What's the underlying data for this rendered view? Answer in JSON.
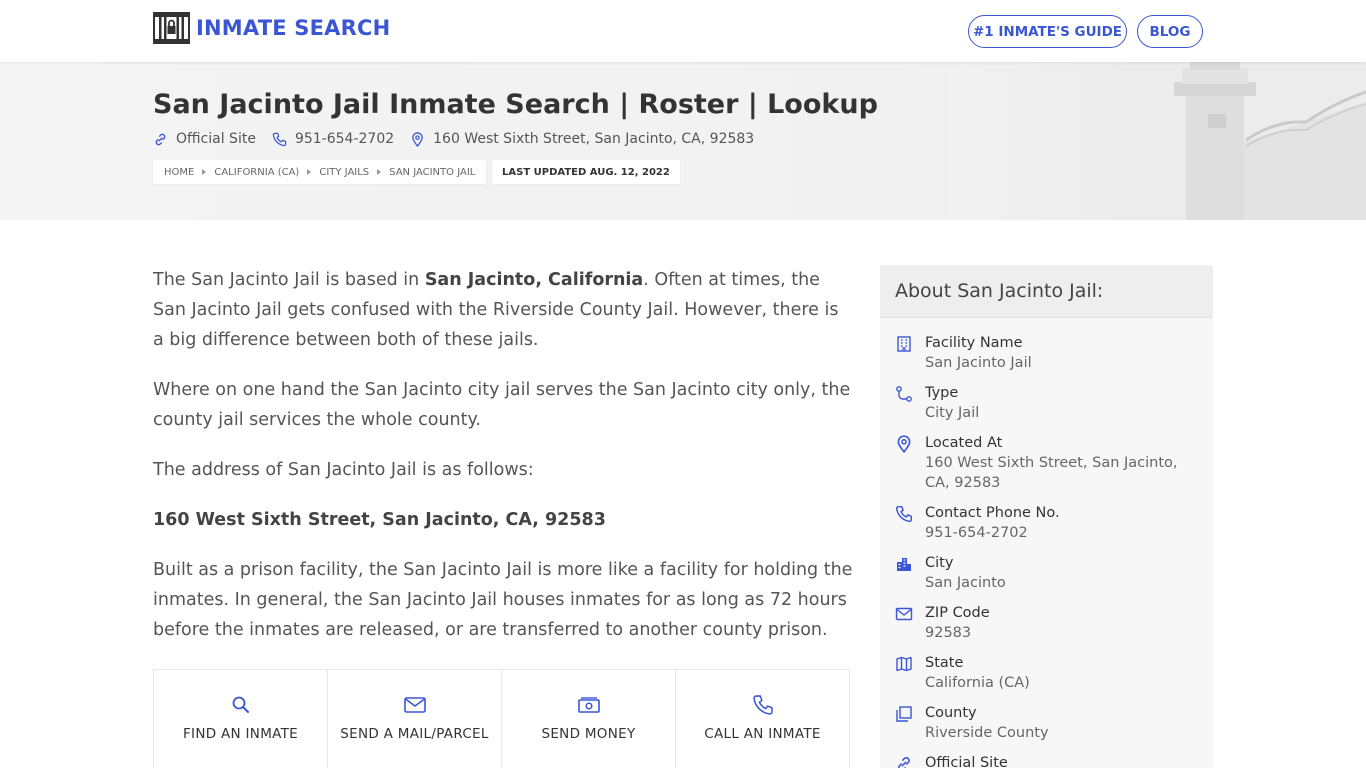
{
  "header": {
    "logo_text": "INMATE SEARCH",
    "nav": {
      "guide_label": "#1 INMATE'S GUIDE",
      "blog_label": "BLOG"
    }
  },
  "hero": {
    "title": "San Jacinto Jail Inmate Search | Roster | Lookup",
    "meta": {
      "official_site": "Official Site",
      "phone": "951-654-2702",
      "address": "160 West Sixth Street, San Jacinto, CA, 92583"
    },
    "breadcrumb": [
      "HOME",
      "CALIFORNIA (CA)",
      "CITY JAILS",
      "SAN JACINTO JAIL"
    ],
    "last_updated": "LAST UPDATED AUG. 12, 2022"
  },
  "content": {
    "p1_a": "The San Jacinto Jail is based in ",
    "p1_b": "San Jacinto, California",
    "p1_c": ". Often at times, the San Jacinto Jail gets confused with the Riverside County Jail. However, there is a big difference between both of these jails.",
    "p2": "Where on one hand the San Jacinto city jail serves the San Jacinto city only, the county jail services the whole county.",
    "p3": "The address of San Jacinto Jail is as follows:",
    "p4": "160 West Sixth Street, San Jacinto, CA, 92583",
    "p5": "Built as a prison facility, the San Jacinto Jail is more like a facility for holding the inmates. In general, the San Jacinto Jail houses inmates for as long as 72 hours before the inmates are released, or are transferred to another county prison."
  },
  "actions": [
    {
      "label": "FIND AN INMATE",
      "icon": "search-icon"
    },
    {
      "label": "SEND A MAIL/PARCEL",
      "icon": "mail-icon"
    },
    {
      "label": "SEND MONEY",
      "icon": "money-icon"
    },
    {
      "label": "CALL AN INMATE",
      "icon": "phone-icon"
    }
  ],
  "sidebar": {
    "title": "About San Jacinto Jail:",
    "items": [
      {
        "label": "Facility Name",
        "value": "San Jacinto Jail",
        "icon": "building-icon"
      },
      {
        "label": "Type",
        "value": "City Jail",
        "icon": "route-icon"
      },
      {
        "label": "Located At",
        "value": "160 West Sixth Street, San Jacinto, CA, 92583",
        "icon": "map-pin-icon"
      },
      {
        "label": "Contact Phone No.",
        "value": "951-654-2702",
        "icon": "phone-icon"
      },
      {
        "label": "City",
        "value": "San Jacinto",
        "icon": "city-icon"
      },
      {
        "label": "ZIP Code",
        "value": "92583",
        "icon": "envelope-icon"
      },
      {
        "label": "State",
        "value": "California (CA)",
        "icon": "map-icon"
      },
      {
        "label": "County",
        "value": "Riverside County",
        "icon": "copy-icon"
      },
      {
        "label": "Official Site",
        "value": "",
        "icon": "link-icon"
      }
    ]
  },
  "colors": {
    "brand": "#3a56d4",
    "text": "#555555",
    "heading": "#333333"
  }
}
